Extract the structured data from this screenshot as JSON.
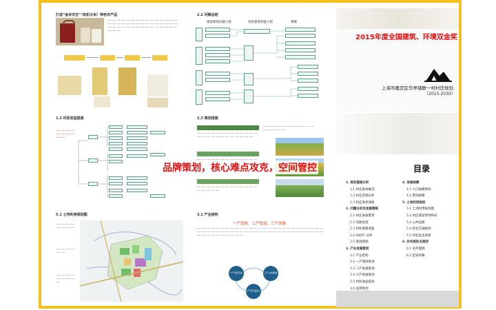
{
  "cover": {
    "award": "2015年度全国建筑、环境双金奖",
    "title": "上海市嘉定区华亭镇联一村村庄规划",
    "years": "（2015-2030）"
  },
  "banner": "品牌策划，核心难点攻克，空间管控",
  "pages": {
    "p1": {
      "title": "打造“金米农庄”（有机大米）特色农产品"
    },
    "p2": {
      "title": "2.2 问题总结",
      "col1": "规划策划问题小结",
      "col2": "村民意愿调查小结",
      "col3": "策略"
    },
    "p3": {
      "title": "1.3 村民收益提高"
    },
    "p4": {
      "title": "2.3 策划措施"
    },
    "p5": {
      "title": "5.1 土地利用规划图"
    },
    "p6": {
      "title": "3.1 产业结构",
      "subtitle": "一产增收、二产增加、三产发展",
      "c1": "一产 稳定农业",
      "c2": "三产 乡村旅游",
      "c3": "二产 农产品加工"
    }
  },
  "toc": {
    "title": "目录",
    "left": [
      "1. 现状基础分析",
      "1.1 村庄基本概况",
      "1.2 村庄资源分析",
      "1.3 村庄现状调研",
      "2. 问题分析及发展策略",
      "2.1 村庄发展需求",
      "2.2 问题总结",
      "2.3 村民意愿调查",
      "2.4 SWOT 分析",
      "2.5 策划措施",
      "3. 产业发展策划",
      "3.1 产业结构",
      "3.2 一产增效策划",
      "3.3 二产发展策划",
      "3.4 三产发展策划",
      "3.5 村民收益提高",
      "3.6 品牌策划"
    ],
    "right": [
      "4. 发展规模",
      "4.1 人口规模预测",
      "4.2 用地规模",
      "5. 土地利用规划",
      "5.1 土地利用规划图",
      "5.2 村庄建设用地布局",
      "5.3 公共设施",
      "5.4 综合交通规划",
      "5.5 绿化生态系统",
      "6. 农村居民点规划",
      "6.1 总平面图",
      "6.2 区域鸟瞰"
    ]
  },
  "colors": {
    "frame": "#f3c11b",
    "red": "#e01010",
    "teal": "#2e7d6b",
    "gray": "#d9d9d9"
  }
}
